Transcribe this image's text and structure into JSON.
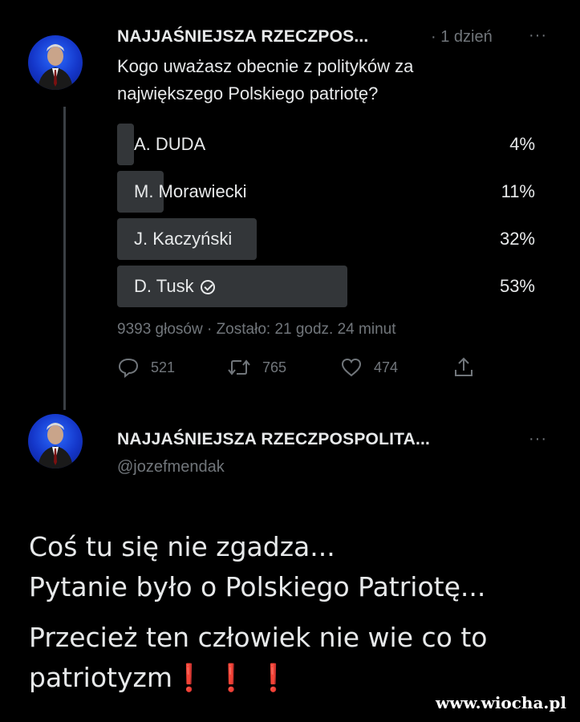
{
  "tweet1": {
    "display_name": "NAJJAŚNIEJSZA RZECZPOS...",
    "time": "· 1 dzień",
    "more": "···",
    "text_line1": "Kogo uważasz obecnie z polityków za",
    "text_line2": "największego Polskiego patriotę?",
    "poll": {
      "options": [
        {
          "label": "A. DUDA",
          "percent": "4%",
          "fraction": 0.04
        },
        {
          "label": "M. Morawiecki",
          "percent": "11%",
          "fraction": 0.11
        },
        {
          "label": "J. Kaczyński",
          "percent": "32%",
          "fraction": 0.32
        },
        {
          "label": "D. Tusk",
          "percent": "53%",
          "fraction": 0.53,
          "winner": true
        }
      ],
      "info": "9393 głosów · Zostało: 21 godz. 24 minut"
    },
    "actions": {
      "reply_count": "521",
      "retweet_count": "765",
      "like_count": "474"
    }
  },
  "tweet2": {
    "display_name": "NAJJAŚNIEJSZA RZECZPOSPOLITA...",
    "handle": "@jozefmendak",
    "more": "···",
    "body_line1": "Coś  tu się nie zgadza...",
    "body_line2": "Pytanie było o Polskiego Patriotę...",
    "body_line3": "Przecież ten człowiek nie wie co to",
    "body_line4": "patriotyzm",
    "body_emoji": "❗ ❗ ❗"
  },
  "watermark": "www.wiocha.pl",
  "icons": [
    "reply-icon",
    "retweet-icon",
    "like-icon",
    "share-icon",
    "verified-check-icon"
  ],
  "colors": {
    "background": "#000000",
    "text": "#e7e9ea",
    "muted": "#71767b",
    "poll_fill": "#333639",
    "avatar": "#1436c9",
    "exclamation": "#e0202a"
  }
}
